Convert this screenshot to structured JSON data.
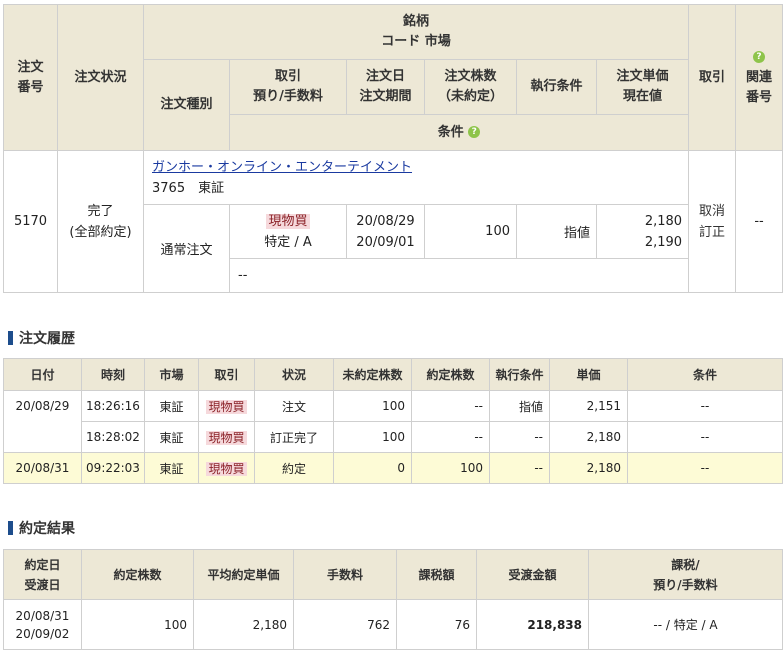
{
  "order": {
    "headers": {
      "order_no_1": "注文",
      "order_no_2": "番号",
      "status": "注文状況",
      "stock_1": "銘柄",
      "stock_2": "コード  市場",
      "trade_1": "取引",
      "trade_2": "預り/手数料",
      "order_date_1": "注文日",
      "order_date_2": "注文期間",
      "qty_1": "注文株数",
      "qty_2": "（未約定）",
      "exec_cond": "執行条件",
      "price_1": "注文単価",
      "price_2": "現在値",
      "order_type": "注文種別",
      "condition": "条件",
      "action": "取引",
      "related_1": "関連",
      "related_2": "番号"
    },
    "row": {
      "order_no": "5170",
      "status_1": "完了",
      "status_2": "(全部約定)",
      "stock_name": "ガンホー・オンライン・エンターテイメント",
      "code_market": "3765　東証",
      "order_type": "通常注文",
      "trade_type": "現物買",
      "account": "特定 / A",
      "order_date": "20/08/29",
      "order_period": "20/09/01",
      "qty": "100",
      "exec_cond": "指値",
      "order_price": "2,180",
      "current_price": "2,190",
      "condition": "--",
      "action_cancel": "取消",
      "action_modify": "訂正",
      "related_no": "--"
    }
  },
  "history": {
    "title": "注文履歴",
    "headers": [
      "日付",
      "時刻",
      "市場",
      "取引",
      "状況",
      "未約定株数",
      "約定株数",
      "執行条件",
      "単価",
      "条件"
    ],
    "rows": [
      {
        "date": "20/08/29",
        "time": "18:26:16",
        "market": "東証",
        "trade": "現物買",
        "status": "注文",
        "unfilled": "100",
        "filled": "--",
        "cond": "指値",
        "price": "2,151",
        "condition": "--"
      },
      {
        "date": "",
        "time": "18:28:02",
        "market": "東証",
        "trade": "現物買",
        "status": "訂正完了",
        "unfilled": "100",
        "filled": "--",
        "cond": "--",
        "price": "2,180",
        "condition": "--"
      },
      {
        "date": "20/08/31",
        "time": "09:22:03",
        "market": "東証",
        "trade": "現物買",
        "status": "約定",
        "unfilled": "0",
        "filled": "100",
        "cond": "--",
        "price": "2,180",
        "condition": "--"
      }
    ]
  },
  "execution": {
    "title": "約定結果",
    "headers": {
      "date_1": "約定日",
      "date_2": "受渡日",
      "qty": "約定株数",
      "avg_price": "平均約定単価",
      "fee": "手数料",
      "tax": "課税額",
      "amount": "受渡金額",
      "taxation_1": "課税/",
      "taxation_2": "預り/手数料"
    },
    "row": {
      "exec_date": "20/08/31",
      "settle_date": "20/09/02",
      "qty": "100",
      "avg_price": "2,180",
      "fee": "762",
      "tax": "76",
      "amount": "218,838",
      "taxation": "-- / 特定 / A"
    }
  },
  "icons": {
    "help": "?"
  },
  "colors": {
    "header_bg": "#ede8d6",
    "highlight_row": "#fdfbd6",
    "buy_badge_bg": "#f6d9dc",
    "link": "#1a3aa0",
    "section_bar": "#1d4d8c",
    "help_icon": "#8ec44a"
  }
}
